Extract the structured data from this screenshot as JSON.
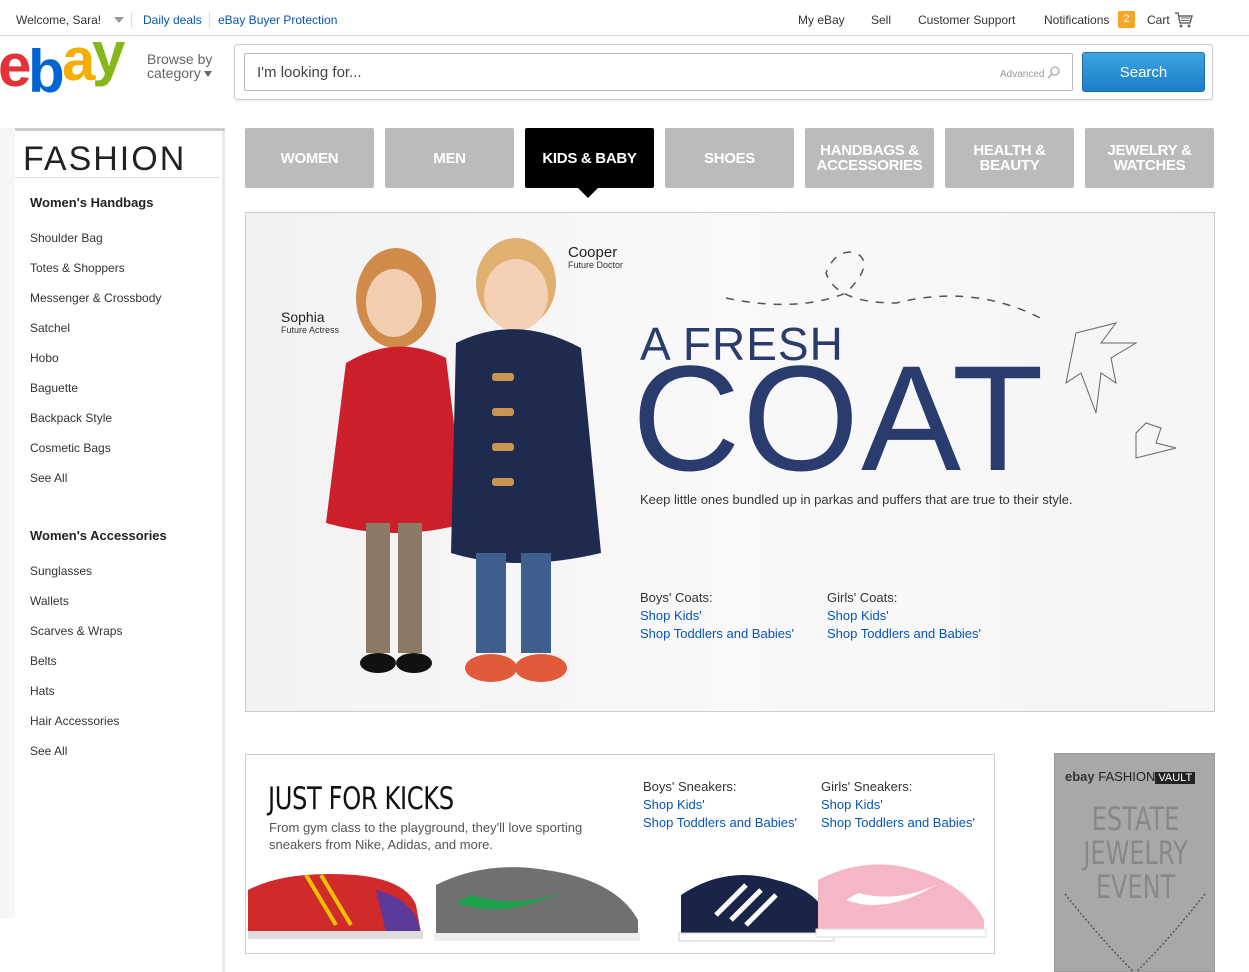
{
  "topbar": {
    "welcome": "Welcome, Sara!",
    "daily_deals": "Daily deals",
    "buyer_protection": "eBay Buyer Protection",
    "my_ebay": "My eBay",
    "sell": "Sell",
    "customer_support": "Customer Support",
    "notifications": "Notifications",
    "notification_count": "2",
    "cart": "Cart"
  },
  "header": {
    "logo_text": "ebay",
    "browse_line1": "Browse by",
    "browse_line2": "category",
    "search_placeholder": "I'm looking for...",
    "advanced": "Advanced",
    "search_button": "Search"
  },
  "sidebar": {
    "title": "FASHION",
    "sections": [
      {
        "heading": "Women's Handbags",
        "items": [
          "Shoulder Bag",
          "Totes & Shoppers",
          "Messenger & Crossbody",
          "Satchel",
          "Hobo",
          "Baguette",
          "Backpack Style",
          "Cosmetic Bags",
          "See All"
        ]
      },
      {
        "heading": "Women's Accessories",
        "items": [
          "Sunglasses",
          "Wallets",
          "Scarves & Wraps",
          "Belts",
          "Hats",
          "Hair Accessories",
          "See All"
        ]
      }
    ]
  },
  "tabs": [
    {
      "label": "WOMEN",
      "active": false
    },
    {
      "label": "MEN",
      "active": false
    },
    {
      "label": "KIDS & BABY",
      "active": true
    },
    {
      "label": "SHOES",
      "active": false
    },
    {
      "label": "HANDBAGS & ACCESSORIES",
      "active": false
    },
    {
      "label": "HEALTH & BEAUTY",
      "active": false
    },
    {
      "label": "JEWELRY & WATCHES",
      "active": false
    }
  ],
  "hero": {
    "kid1_name": "Sophia",
    "kid1_role": "Future Actress",
    "kid2_name": "Cooper",
    "kid2_role": "Future Doctor",
    "headline_small": "A FRESH",
    "headline_big": "COAT",
    "subline": "Keep little ones bundled up in parkas and puffers that are true to their style.",
    "boys_heading": "Boys' Coats:",
    "boys_links": [
      "Shop Kids'",
      "Shop Toddlers and Babies'"
    ],
    "girls_heading": "Girls' Coats:",
    "girls_links": [
      "Shop Kids'",
      "Shop Toddlers and Babies'"
    ]
  },
  "kicks": {
    "title": "JUST FOR KICKS",
    "subline": "From gym class to the playground, they'll love sporting sneakers from Nike, Adidas, and more.",
    "boys_heading": "Boys' Sneakers:",
    "boys_links": [
      "Shop Kids'",
      "Shop Toddlers and Babies'"
    ],
    "girls_heading": "Girls' Sneakers:",
    "girls_links": [
      "Shop Kids'",
      "Shop Toddlers and Babies'"
    ]
  },
  "vault": {
    "brand": "ebay",
    "fashion": "FASHION",
    "label": "VAULT",
    "title_lines": [
      "ESTATE",
      "JEWELRY",
      "EVENT"
    ]
  },
  "colors": {
    "ebay_red": "#e53238",
    "ebay_blue": "#0064d2",
    "ebay_yellow": "#f5af02",
    "ebay_green": "#86b817",
    "link_blue": "#0654ba",
    "headline_navy": "#2a3b6e",
    "tab_gray": "#bbbbbb",
    "tab_active": "#000000",
    "search_button": "#1a7ec8",
    "badge_orange": "#f5a623"
  }
}
